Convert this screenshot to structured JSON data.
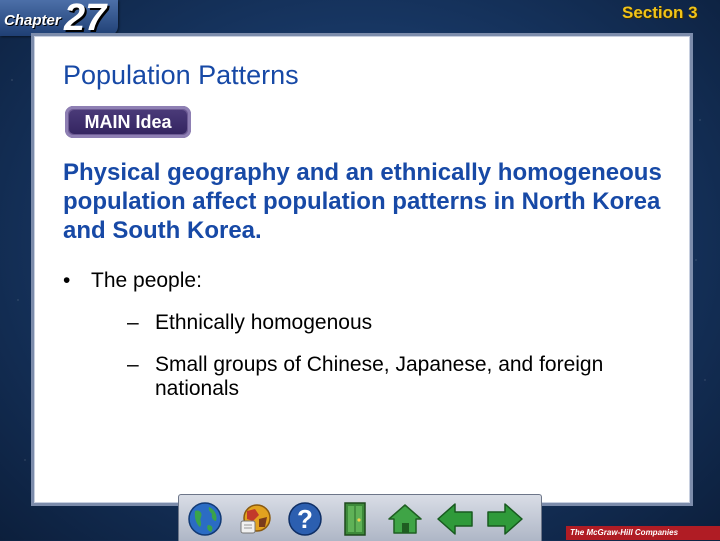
{
  "header": {
    "chapter_label": "Chapter",
    "chapter_number": "27",
    "section_label": "Section 3"
  },
  "slide": {
    "title": "Population Patterns",
    "badge": "MAIN Idea",
    "main_idea": "Physical geography and an ethnically homogeneous population affect population patterns in North Korea and South Korea.",
    "bullets": [
      {
        "text": "The people:",
        "sub": [
          "Ethnically homogenous",
          "Small groups of Chinese, Japanese, and foreign nationals"
        ]
      }
    ],
    "bullet_symbol": "•",
    "dash_symbol": "–"
  },
  "navbar": {
    "buttons": [
      {
        "name": "globe-icon"
      },
      {
        "name": "resources-icon"
      },
      {
        "name": "help-icon"
      },
      {
        "name": "exit-door-icon"
      },
      {
        "name": "home-icon"
      },
      {
        "name": "back-arrow-icon"
      },
      {
        "name": "forward-arrow-icon"
      }
    ]
  },
  "footer": {
    "publisher": "The McGraw-Hill Companies"
  },
  "colors": {
    "title_blue": "#1749a6",
    "section_gold": "#f2c418",
    "badge_purple": "#4a3a78",
    "arrow_green": "#2f9a3a"
  }
}
